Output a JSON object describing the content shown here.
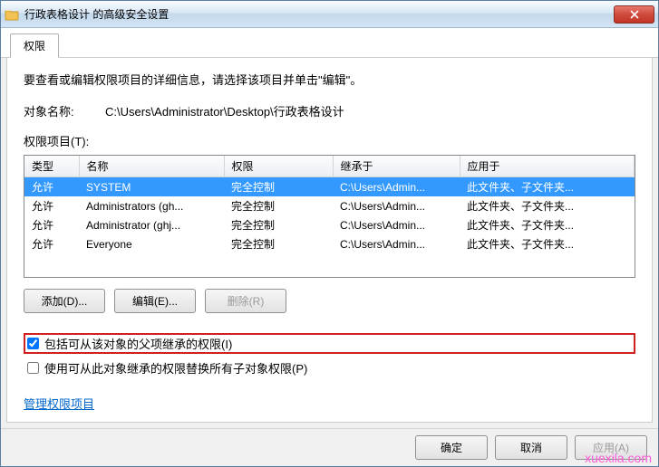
{
  "titlebar": {
    "title": "行政表格设计 的高级安全设置"
  },
  "tab": {
    "label": "权限"
  },
  "instruction": "要查看或编辑权限项目的详细信息，请选择该项目并单击\"编辑\"。",
  "object": {
    "label": "对象名称:",
    "value": "C:\\Users\\Administrator\\Desktop\\行政表格设计"
  },
  "perm_list_label": "权限项目(T):",
  "columns": {
    "type": "类型",
    "name": "名称",
    "perm": "权限",
    "inherit": "继承于",
    "apply": "应用于"
  },
  "rows": [
    {
      "type": "允许",
      "name": "SYSTEM",
      "perm": "完全控制",
      "inherit": "C:\\Users\\Admin...",
      "apply": "此文件夹、子文件夹...",
      "selected": true
    },
    {
      "type": "允许",
      "name": "Administrators (gh...",
      "perm": "完全控制",
      "inherit": "C:\\Users\\Admin...",
      "apply": "此文件夹、子文件夹..."
    },
    {
      "type": "允许",
      "name": "Administrator (ghj...",
      "perm": "完全控制",
      "inherit": "C:\\Users\\Admin...",
      "apply": "此文件夹、子文件夹..."
    },
    {
      "type": "允许",
      "name": "Everyone",
      "perm": "完全控制",
      "inherit": "C:\\Users\\Admin...",
      "apply": "此文件夹、子文件夹..."
    }
  ],
  "buttons": {
    "add": "添加(D)...",
    "edit": "编辑(E)...",
    "remove": "删除(R)"
  },
  "checkboxes": {
    "include": "包括可从该对象的父项继承的权限(I)",
    "replace": "使用可从此对象继承的权限替换所有子对象权限(P)"
  },
  "link": "管理权限项目",
  "footer": {
    "ok": "确定",
    "cancel": "取消",
    "apply": "应用(A)"
  },
  "watermark": "xuexila.com"
}
